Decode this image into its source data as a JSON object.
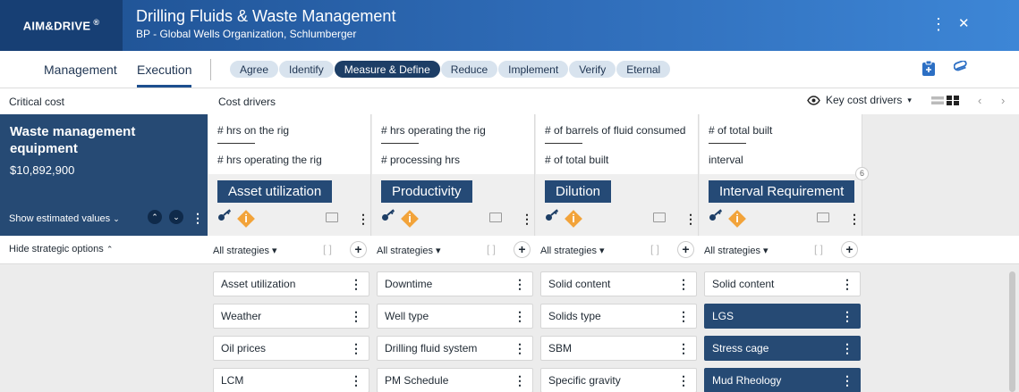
{
  "header": {
    "logo": "AIM&DRIVE",
    "logo_mark": "®",
    "title": "Drilling Fluids & Waste Management",
    "subtitle": "BP - Global Wells Organization, Schlumberger",
    "more_icon": "⋮",
    "close_icon": "✕"
  },
  "nav": {
    "tabs": [
      {
        "label": "Management"
      },
      {
        "label": "Execution"
      }
    ],
    "stages": [
      "Agree",
      "Identify",
      "Measure & Define",
      "Reduce",
      "Implement",
      "Verify",
      "Eternal"
    ],
    "current_stage": "Measure & Define"
  },
  "subheader": {
    "critical_cost_label": "Critical cost",
    "cost_drivers_label": "Cost drivers",
    "key_cost_drivers_label": "Key cost drivers",
    "dropdown_arrow": "▾"
  },
  "critical": {
    "title": "Waste management equipment",
    "amount": "$10,892,900",
    "show_estimated": "Show estimated values"
  },
  "drivers": [
    {
      "numerator": "# hrs on the rig",
      "denominator": "# hrs operating the rig",
      "name": "Asset utilization"
    },
    {
      "numerator": "# hrs operating the rig",
      "denominator": "# processing hrs",
      "name": "Productivity"
    },
    {
      "numerator": "# of barrels of fluid consumed",
      "denominator": "# of total built",
      "name": "Dilution"
    },
    {
      "numerator": "# of total built",
      "denominator": "interval",
      "name": "Interval Requirement"
    }
  ],
  "hidden_driver_count": "6",
  "filters": {
    "hide_label": "Hide strategic options",
    "all_strategies": "All strategies ▾"
  },
  "options": [
    [
      {
        "label": "Asset utilization",
        "selected": false
      },
      {
        "label": "Weather",
        "selected": false
      },
      {
        "label": "Oil prices",
        "selected": false
      },
      {
        "label": "LCM",
        "selected": false
      }
    ],
    [
      {
        "label": "Downtime",
        "selected": false
      },
      {
        "label": "Well type",
        "selected": false
      },
      {
        "label": "Drilling fluid system",
        "selected": false
      },
      {
        "label": "PM Schedule",
        "selected": false
      }
    ],
    [
      {
        "label": "Solid content",
        "selected": false
      },
      {
        "label": "Solids type",
        "selected": false
      },
      {
        "label": "SBM",
        "selected": false
      },
      {
        "label": "Specific gravity",
        "selected": false
      }
    ],
    [
      {
        "label": "Solid content",
        "selected": false
      },
      {
        "label": "LGS",
        "selected": true
      },
      {
        "label": "Stress cage",
        "selected": true
      },
      {
        "label": "Mud Rheology",
        "selected": true
      }
    ]
  ],
  "colors": {
    "header_dark": "#173f74",
    "header_gradient_start": "#1d4f8f",
    "header_gradient_end": "#3d86d6",
    "stage_active": "#1d3e66",
    "stage_idle": "#d8e3ee",
    "selected_option": "#264a74",
    "info_diamond": "#f2a33a"
  }
}
